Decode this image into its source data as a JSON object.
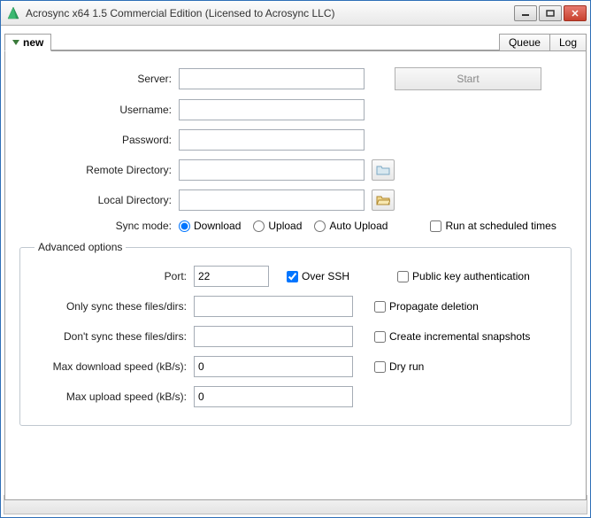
{
  "window": {
    "title": "Acrosync x64 1.5 Commercial Edition (Licensed to Acrosync LLC)"
  },
  "tabs": {
    "profile": "new",
    "queue": "Queue",
    "log": "Log"
  },
  "buttons": {
    "start": "Start"
  },
  "labels": {
    "server": "Server:",
    "username": "Username:",
    "password": "Password:",
    "remote_dir": "Remote Directory:",
    "local_dir": "Local Directory:",
    "sync_mode": "Sync mode:",
    "run_scheduled": "Run at scheduled times",
    "advanced": "Advanced options",
    "port": "Port:",
    "over_ssh": "Over SSH",
    "pubkey": "Public key authentication",
    "only_sync": "Only sync these files/dirs:",
    "propagate": "Propagate deletion",
    "dont_sync": "Don't sync these files/dirs:",
    "snapshots": "Create incremental snapshots",
    "max_down": "Max download speed (kB/s):",
    "dry_run": "Dry run",
    "max_up": "Max upload speed (kB/s):"
  },
  "sync_modes": {
    "download": "Download",
    "upload": "Upload",
    "auto_upload": "Auto Upload"
  },
  "values": {
    "server": "",
    "username": "",
    "password": "",
    "remote_dir": "",
    "local_dir": "",
    "port": "22",
    "only_sync": "",
    "dont_sync": "",
    "max_down": "0",
    "max_up": "0"
  }
}
